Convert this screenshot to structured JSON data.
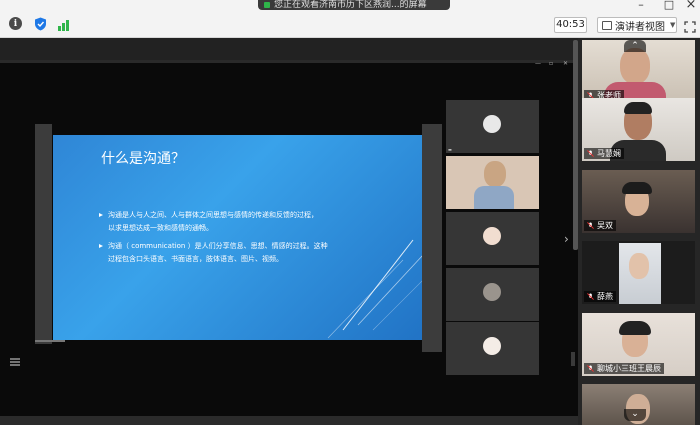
{
  "topbar": {
    "share_banner": "您正在观看济南市历下区燕润...的屏幕",
    "timer": "40:53",
    "view_label": "演讲者视图",
    "minimize": "–",
    "maximize": "□",
    "close": "×",
    "info_glyph": "i"
  },
  "slide": {
    "title": "什么是沟通？",
    "bullet1_line1": "沟通是人与人之间、人与群体之间思想与感情的传递和反馈的过程，",
    "bullet1_line2": "以求思想达成一致和感情的通畅。",
    "bullet2_line1": "沟通（ communication ）是人们分享信息、思想、情感的过程。这种",
    "bullet2_line2": "过程包含口头语言、书面语言，肢体语言、图片、视频。"
  },
  "participants": [
    {
      "name": "张老师"
    },
    {
      "name": "马慧娴"
    },
    {
      "name": "吴双"
    },
    {
      "name": "薛燕"
    },
    {
      "name": "聊城小三班王晨辰"
    }
  ],
  "colors": {
    "accent_green": "#2fb54a",
    "shield_blue": "#1e78e6",
    "slide_blue": "#2f86d6"
  },
  "icons": {
    "info": "info-icon",
    "shield": "shield-icon",
    "signal": "signal-icon",
    "view": "speaker-view-icon",
    "fullscreen": "fullscreen-icon",
    "mic": "mic-muted-icon"
  }
}
